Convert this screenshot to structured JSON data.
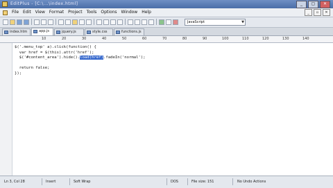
{
  "window": {
    "title": "EditPlus - [C:\\...\\index.html]",
    "buttons": [
      "_",
      "▢",
      "✕"
    ]
  },
  "menu": {
    "items": [
      "File",
      "Edit",
      "View",
      "Format",
      "Project",
      "Tools",
      "Options",
      "Window",
      "Help"
    ],
    "mdi_buttons": [
      "_",
      "▫",
      "✕"
    ]
  },
  "toolbar": {
    "syntax_value": "JavaScript"
  },
  "tabs": [
    "index.htm",
    "app.js",
    "jquery.js",
    "style.css",
    "functions.js"
  ],
  "ruler": {
    "ticks": [
      "10",
      "20",
      "30",
      "40",
      "50",
      "60",
      "70",
      "80",
      "90",
      "100",
      "110",
      "120",
      "130",
      "140"
    ]
  },
  "editor": {
    "lines": [
      {
        "pre": "$('.menu_top' a).click(function() {",
        "sel": "",
        "post": ""
      },
      {
        "pre": "  var href = $(this).attr('href');",
        "sel": "",
        "post": ""
      },
      {
        "pre": "  $('#content_area').hide().",
        "sel": "load(href)",
        "post": ".fadeIn('normal');"
      },
      {
        "pre": "",
        "sel": "",
        "post": ""
      },
      {
        "pre": "  return false;",
        "sel": "",
        "post": ""
      },
      {
        "pre": "});",
        "sel": "",
        "post": ""
      }
    ]
  },
  "status": {
    "position": "Ln 3, Col 28",
    "mode": "Insert",
    "wrap": "Soft Wrap",
    "encoding": "DOS",
    "size": "File size: 151",
    "edited": "No Undo Actions"
  }
}
